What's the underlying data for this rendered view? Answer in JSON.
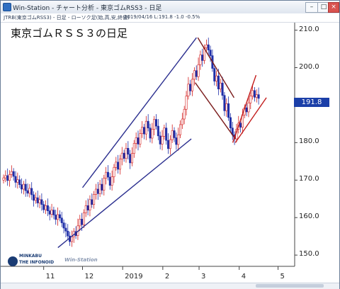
{
  "window": {
    "title": "Win-Station - チャート分析 - 東京ゴムRSS3 - 日足",
    "buttons": {
      "minimize": "–",
      "maximize": "□",
      "close": "×"
    }
  },
  "infobar": {
    "left": "JTRB(東京ゴムRSS3) - 日足 - ローソク足(始,高,安,終値)",
    "right": "2019/04/16   L:191.8   -1.0   -0.5%"
  },
  "chart": {
    "title": "東京ゴムＲＳＳ３の日足",
    "last_price": "191.8",
    "logo": {
      "line1": "MINKABU",
      "line2": "THE INFONOID",
      "line3": "Win-Station"
    }
  },
  "chart_data": {
    "type": "candlestick",
    "ylim": [
      147,
      212
    ],
    "yticks": [
      "210.0",
      "200.0",
      "190.0",
      "180.0",
      "170.0",
      "160.0",
      "150.0"
    ],
    "ytick_values": [
      210,
      200,
      190,
      180,
      170,
      160,
      150
    ],
    "xticks": [
      "11",
      "12",
      "2019",
      "2",
      "3",
      "4",
      "5"
    ],
    "xtick_dates": [
      "2018-11-01",
      "2018-12-01",
      "2019-01-01",
      "2019-02-01",
      "2019-03-01",
      "2019-04-01",
      "2019-05-01"
    ],
    "first_date": "2018-10-01",
    "last_date": "2019-04-16",
    "x_end_date": "2019-05-10",
    "closes": [
      170.6,
      171.2,
      169.9,
      171.5,
      172.3,
      171.0,
      169.4,
      170.1,
      168.8,
      167.6,
      168.9,
      167.2,
      166.5,
      167.8,
      166.1,
      164.6,
      165.3,
      163.9,
      164.8,
      163.5,
      162.1,
      163.2,
      161.8,
      160.9,
      162.0,
      160.7,
      159.5,
      160.8,
      159.9,
      158.6,
      157.2,
      156.4,
      155.1,
      153.6,
      154.9,
      156.3,
      155.2,
      157.8,
      159.6,
      158.1,
      161.3,
      163.2,
      162.0,
      164.8,
      163.5,
      166.2,
      167.6,
      166.4,
      168.9,
      167.3,
      170.5,
      172.1,
      170.8,
      168.6,
      170.9,
      173.4,
      174.8,
      172.9,
      175.6,
      177.2,
      175.8,
      178.5,
      176.9,
      174.6,
      177.1,
      179.8,
      181.3,
      179.6,
      182.4,
      184.1,
      182.3,
      185.7,
      183.9,
      181.2,
      183.6,
      186.2,
      184.4,
      181.8,
      179.6,
      181.7,
      183.9,
      180.6,
      178.4,
      180.8,
      183.2,
      181.3,
      179.5,
      182.1,
      184.8,
      186.3,
      188.9,
      192.4,
      195.6,
      193.8,
      196.9,
      199.2,
      197.6,
      200.8,
      203.4,
      201.9,
      205.3,
      206.1,
      204.7,
      203.2,
      199.8,
      196.4,
      197.8,
      194.3,
      195.9,
      192.6,
      188.5,
      190.4,
      186.7,
      183.9,
      182.1,
      181.0,
      183.6,
      185.2,
      184.1,
      187.4,
      189.3,
      188.2,
      190.6,
      192.4,
      193.9,
      192.1,
      192.8,
      191.8
    ],
    "channels": [
      {
        "name": "rise-channel-upper",
        "color": "#2b2f8f",
        "from": [
          "2018-12-01",
          168
        ],
        "to": [
          "2019-02-27",
          208
        ]
      },
      {
        "name": "rise-channel-lower",
        "color": "#2b2f8f",
        "from": [
          "2018-11-12",
          152
        ],
        "to": [
          "2019-02-23",
          181
        ]
      },
      {
        "name": "fall-channel-upper",
        "color": "#7a1a1a",
        "from": [
          "2019-02-28",
          208
        ],
        "to": [
          "2019-03-28",
          192
        ]
      },
      {
        "name": "fall-channel-lower",
        "color": "#7a1a1a",
        "from": [
          "2019-02-26",
          196
        ],
        "to": [
          "2019-03-29",
          181
        ]
      },
      {
        "name": "rebound-channel-upper",
        "color": "#c21c1c",
        "from": [
          "2019-03-27",
          180
        ],
        "to": [
          "2019-04-14",
          198
        ]
      },
      {
        "name": "rebound-channel-lower",
        "color": "#c21c1c",
        "from": [
          "2019-03-29",
          180
        ],
        "to": [
          "2019-04-22",
          192
        ]
      }
    ],
    "up_color": "#d42020",
    "down_color": "#1f2fa8",
    "grid": false,
    "xlabel": "",
    "ylabel": ""
  }
}
